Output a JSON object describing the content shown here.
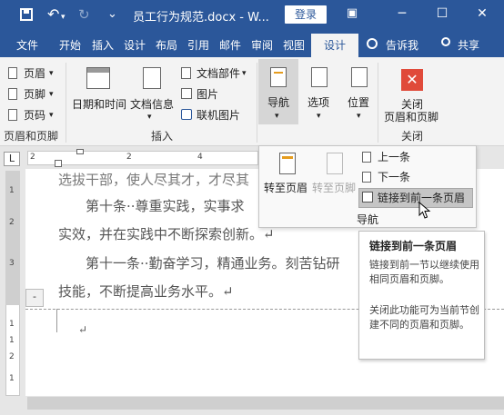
{
  "titlebar": {
    "save_icon": "save-icon",
    "undo_glyph": "↶",
    "redo_glyph": "↻",
    "qat_glyph": "⌄",
    "doc_title": "员工行为规范.docx - W...",
    "login_label": "登录",
    "restore_glyph": "▣",
    "minimize_glyph": "─",
    "maximize_glyph": "☐",
    "close_glyph": "✕"
  },
  "tabs": [
    {
      "label": "文件"
    },
    {
      "label": "开始"
    },
    {
      "label": "插入"
    },
    {
      "label": "设计"
    },
    {
      "label": "布局"
    },
    {
      "label": "引用"
    },
    {
      "label": "邮件"
    },
    {
      "label": "审阅"
    },
    {
      "label": "视图"
    },
    {
      "label": "设计"
    }
  ],
  "tell_me": "告诉我",
  "share": "共享",
  "ribbon": {
    "header": "页眉",
    "footer": "页脚",
    "page_number": "页码",
    "group1_label": "页眉和页脚",
    "date_time": "日期和时间",
    "doc_info": "文档信息",
    "doc_parts": "文档部件",
    "picture": "图片",
    "online_picture": "联机图片",
    "group2_label": "插入",
    "navigate": "导航",
    "options": "选项",
    "position": "位置",
    "close_hf_line1": "关闭",
    "close_hf_line2": "页眉和页脚",
    "group3_label": "关闭"
  },
  "dropdown": {
    "goto_header": "转至页眉",
    "goto_footer": "转至页脚",
    "previous": "上一条",
    "next": "下一条",
    "link_previous": "链接到前一条页眉",
    "group_label": "导航"
  },
  "tooltip": {
    "title": "链接到前一条页眉",
    "line1": "链接到前一节以继续使用相同页眉和页脚。",
    "line2": "关闭此功能可为当前节创建不同的页眉和页脚。"
  },
  "ruler": {
    "corner": "L",
    "nums": [
      "2",
      "2",
      "4"
    ]
  },
  "vruler_nums": [
    "1",
    "2",
    "3",
    "1",
    "1",
    "2",
    "1"
  ],
  "document": {
    "line0": "选拔干部，使人尽其才，才尽其",
    "line1": "第十条··尊重实践，实事求",
    "line2": "实效，并在实践中不断探索创新。↵",
    "line3": "第十一条··勤奋学习，精通业务。刻苦钻研",
    "line4": "技能，不断提高业务水平。↵",
    "header_cursor": "↵",
    "section_tag": "-"
  },
  "colors": {
    "accent": "#2b579a",
    "close_button": "#e04a3a"
  }
}
